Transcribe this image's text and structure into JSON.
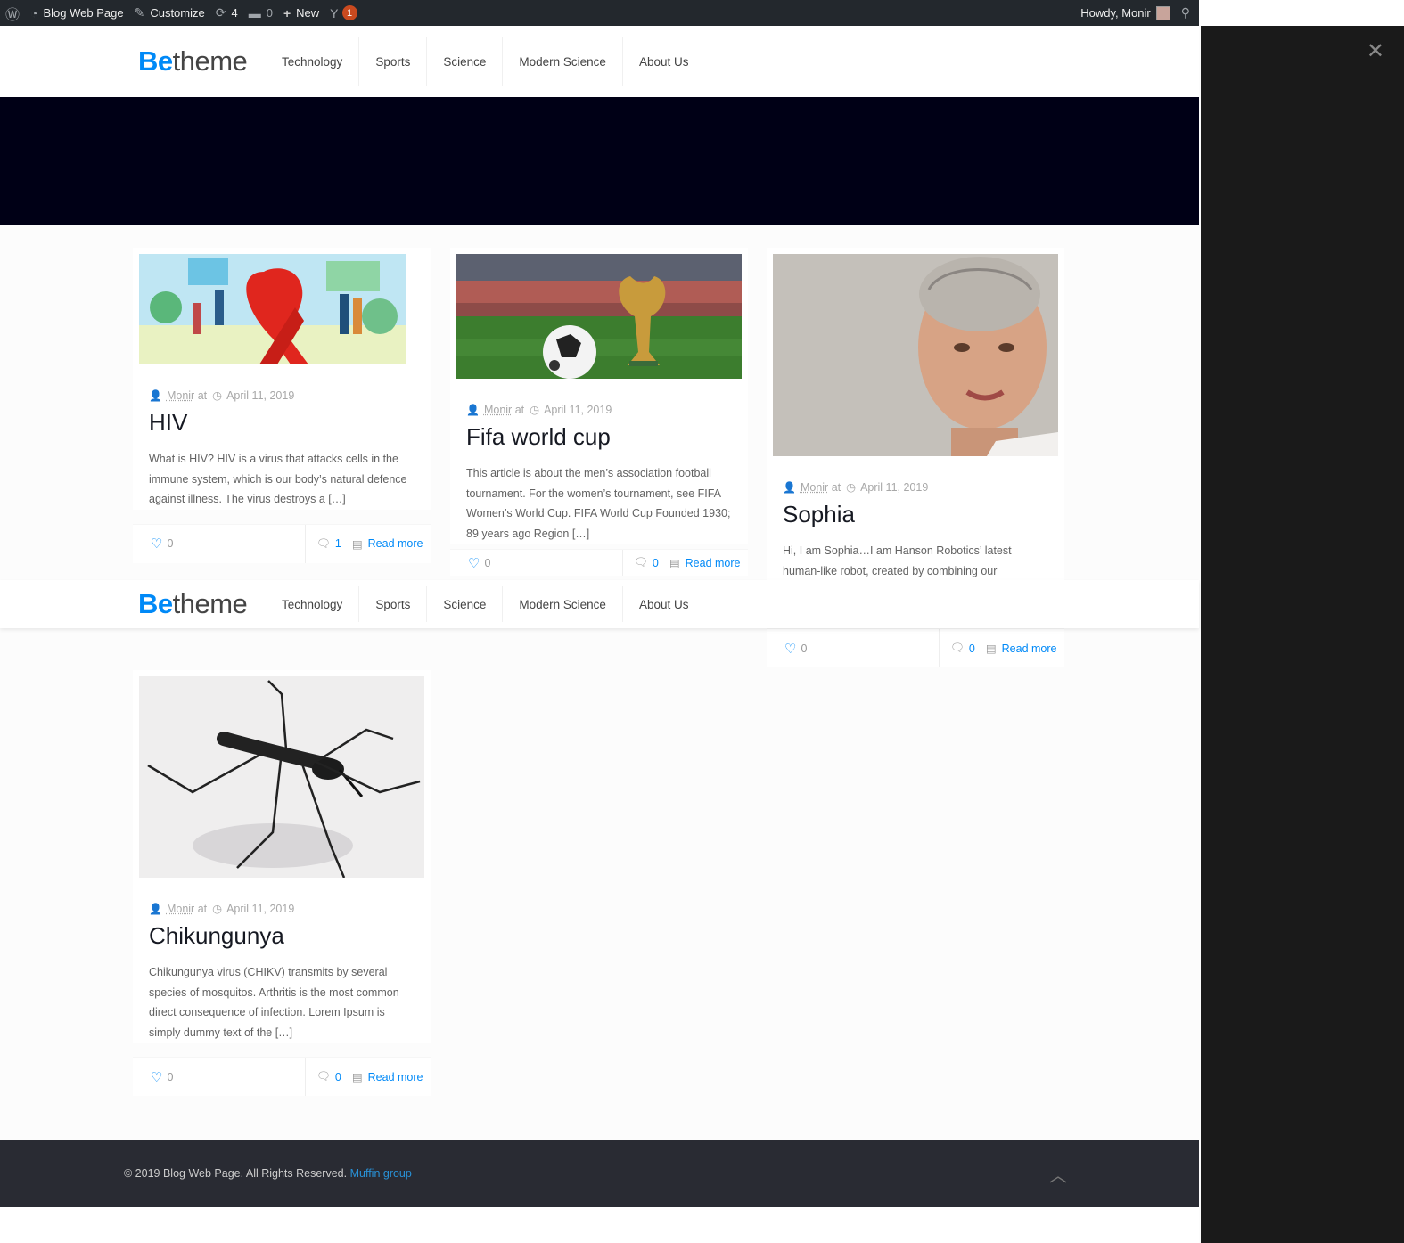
{
  "adminbar": {
    "site_name": "Blog Web Page",
    "customize": "Customize",
    "updates_count": "4",
    "comments_count": "0",
    "new_label": "New",
    "yoast_badge": "1",
    "howdy": "Howdy, Monir"
  },
  "header": {
    "logo_be": "Be",
    "logo_rest": "theme",
    "nav": [
      "Technology",
      "Sports",
      "Science",
      "Modern Science",
      "About Us"
    ]
  },
  "posts": [
    {
      "author": "Monir",
      "at": "at",
      "date": "April 11, 2019",
      "title": "HIV",
      "excerpt": "What is HIV? HIV is a virus that attacks cells in the immune system, which is our body’s natural defence against illness. The virus destroys a […]",
      "likes": "0",
      "comments": "1",
      "read_more": "Read more"
    },
    {
      "author": "Monir",
      "at": "at",
      "date": "April 11, 2019",
      "title": "Fifa world cup",
      "excerpt": "This article is about the men’s association football tournament. For the women’s tournament, see FIFA Women’s World Cup. FIFA World Cup Founded 1930; 89 years ago Region […]",
      "likes": "0",
      "comments": "0",
      "read_more": "Read more"
    },
    {
      "author": "Monir",
      "at": "at",
      "date": "April 11, 2019",
      "title": "Sophia",
      "excerpt": "Hi, I am Sophia…I am Hanson Robotics’ latest human-like robot, created by combining our innovations in science, engineering and artistry. Think of me as […]",
      "likes": "0",
      "comments": "0",
      "read_more": "Read more"
    },
    {
      "author": "Monir",
      "at": "at",
      "date": "April 11, 2019",
      "title": "Chikungunya",
      "excerpt": "Chikungunya virus (CHIKV)  transmits by several species of mosquitos. Arthritis is the most common direct consequence of infection. Lorem Ipsum is simply dummy text of the […]",
      "likes": "0",
      "comments": "0",
      "read_more": "Read more"
    }
  ],
  "footer": {
    "copyright": "© 2019 Blog Web Page. All Rights Reserved.",
    "link": "Muffin group"
  },
  "colors": {
    "accent": "#0089f7",
    "adminbar": "#23282d",
    "hero": "#000016",
    "footer": "#292b33",
    "side_panel": "#1a1a1a"
  }
}
